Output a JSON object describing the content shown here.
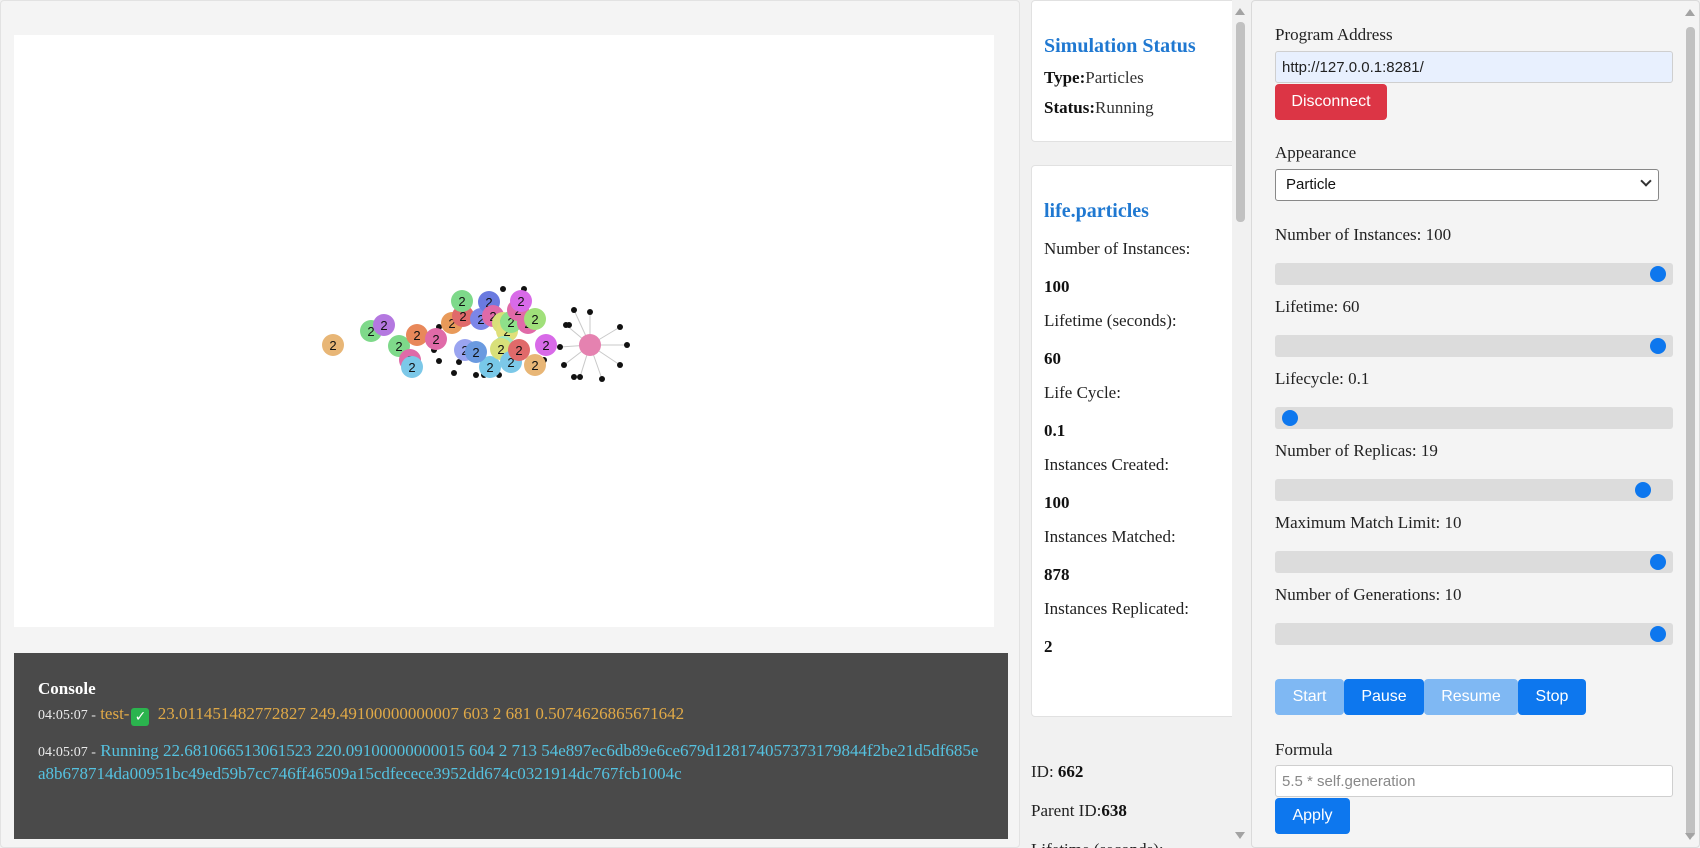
{
  "console": {
    "title": "Console",
    "logs": [
      {
        "time": "04:05:07 -",
        "prefix": "test-",
        "message": "23.011451482772827 249.49100000000007 603 2 681 0.5074626865671642"
      },
      {
        "time": "04:05:07 -",
        "message": "Running 22.681066513061523 220.09100000000015 604 2 713 54e897ec6db89e6ce679d128174057373179844f2be21d5df685ea8b678714da00951bc49ed59b7cc746ff46509a15cdfecece3952dd674c0321914dc767fcb1004c"
      }
    ]
  },
  "status": {
    "title": "Simulation Status",
    "type_label": "Type:",
    "type_value": "Particles",
    "status_label": "Status:",
    "status_value": "Running"
  },
  "particles": {
    "title": "life.particles",
    "stats": [
      {
        "label": "Number of Instances:",
        "value": "100"
      },
      {
        "label": "Lifetime (seconds):",
        "value": "60"
      },
      {
        "label": "Life Cycle:",
        "value": "0.1"
      },
      {
        "label": "Instances Created:",
        "value": "100"
      },
      {
        "label": "Instances Matched:",
        "value": "878"
      },
      {
        "label": "Instances Replicated:",
        "value": "2"
      }
    ]
  },
  "instance": {
    "id_label": "ID:",
    "id_value": "662",
    "parent_label": "Parent ID:",
    "parent_value": "638",
    "lifetime_label": "Lifetime (seconds):"
  },
  "controls": {
    "address_label": "Program Address",
    "address_value": "http://127.0.0.1:8281/",
    "disconnect_label": "Disconnect",
    "appearance_label": "Appearance",
    "appearance_value": "Particle",
    "sliders": [
      {
        "label": "Number of Instances: 100",
        "fraction": 0.99
      },
      {
        "label": "Lifetime: 60",
        "fraction": 0.99
      },
      {
        "label": "Lifecycle: 0.1",
        "fraction": 0.01
      },
      {
        "label": "Number of Replicas: 19",
        "fraction": 0.95
      },
      {
        "label": "Maximum Match Limit: 10",
        "fraction": 0.99
      },
      {
        "label": "Number of Generations: 10",
        "fraction": 0.99
      }
    ],
    "start_label": "Start",
    "pause_label": "Pause",
    "resume_label": "Resume",
    "stop_label": "Stop",
    "formula_label": "Formula",
    "formula_placeholder": "5.5 * self.generation",
    "apply_label": "Apply"
  },
  "particle_node_label": "2",
  "colors": {
    "accent": "#0d77ee",
    "danger": "#dc3545",
    "title_blue": "#1f78d1",
    "console_bg": "#4a4a4a",
    "console_warn": "#e0a947",
    "console_info": "#55c2e0"
  }
}
